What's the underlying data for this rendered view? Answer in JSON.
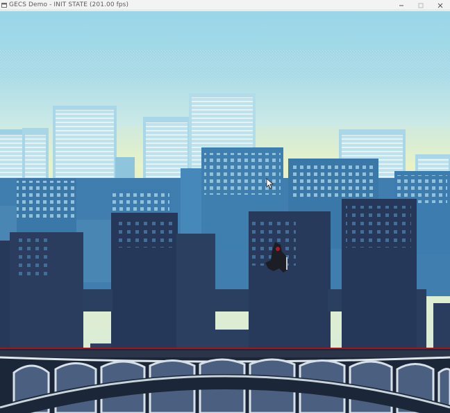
{
  "window": {
    "title": "GECS Demo - INIT STATE (201.00 fps)",
    "app_icon": "window-app-icon",
    "controls": {
      "minimize_icon": "minimize-icon",
      "maximize_icon": "maximize-icon",
      "close_icon": "close-icon"
    }
  },
  "scene": {
    "colors": {
      "sky_top": "#9fd7e7",
      "sky_bottom": "#e6f1c4",
      "far_buildings": "#c5e4ee",
      "mid_buildings": "#4a86b4",
      "near_buildings": "#263754",
      "bridge": "#1b2738",
      "bridge_highlight": "#dfe6ec",
      "water_band": "#4b5f80",
      "horizon_line": "#a8121a"
    },
    "player": "hooded-warrior",
    "cursor": "mouse-pointer-icon"
  }
}
